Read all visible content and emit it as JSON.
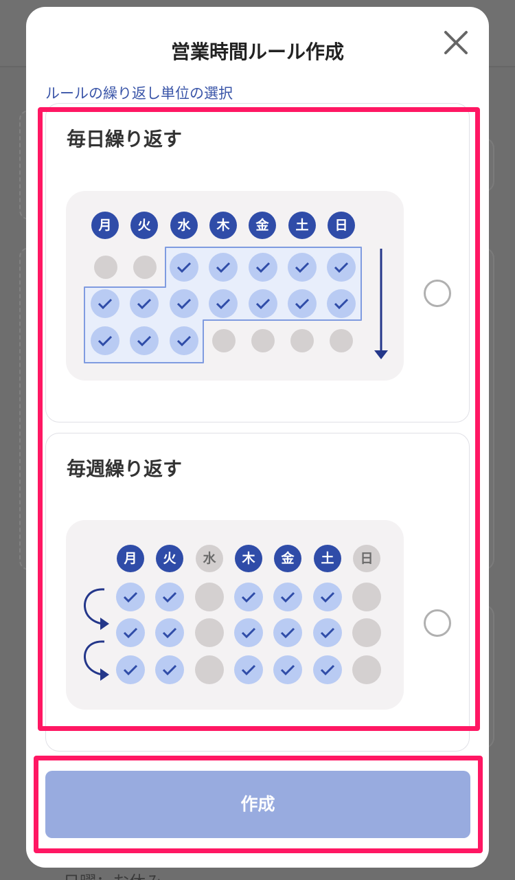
{
  "modal": {
    "title": "営業時間ルール作成",
    "section_label": "ルールの繰り返し単位の選択",
    "create_label": "作成"
  },
  "options": [
    {
      "title": "毎日繰り返す",
      "days": [
        "月",
        "火",
        "水",
        "木",
        "金",
        "土",
        "日"
      ],
      "selected": false
    },
    {
      "title": "毎週繰り返す",
      "days": [
        "月",
        "火",
        "水",
        "木",
        "金",
        "土",
        "日"
      ],
      "active_days": [
        true,
        true,
        false,
        true,
        true,
        true,
        false
      ],
      "selected": false
    }
  ],
  "background": {
    "bottom_text": "日曜：お休み"
  },
  "colors": {
    "accent": "#2f4ca8",
    "highlight": "#ff1763",
    "button_disabled": "#98abdf",
    "check_fill": "#b9cbf3"
  }
}
